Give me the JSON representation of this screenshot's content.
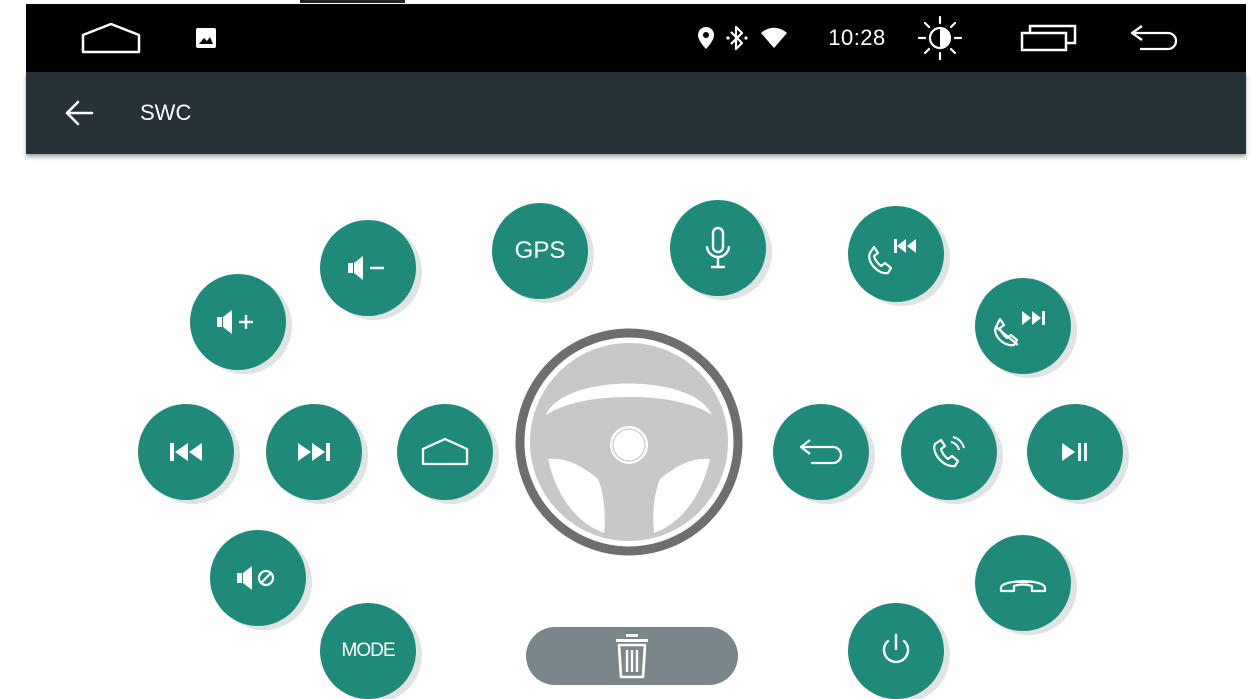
{
  "status_bar": {
    "time": "10:28",
    "icons": [
      "home-outline-icon",
      "gallery-icon",
      "location-pin-icon",
      "bluetooth-icon",
      "wifi-icon",
      "brightness-icon",
      "recent-apps-icon",
      "back-icon"
    ]
  },
  "app_bar": {
    "title": "SWC",
    "back_icon": "arrow-left-icon"
  },
  "swc_buttons": [
    {
      "name": "volume-down",
      "icon": "volume-down-icon"
    },
    {
      "name": "gps",
      "label": "GPS"
    },
    {
      "name": "voice",
      "icon": "microphone-icon"
    },
    {
      "name": "answer-previous",
      "icon": "phone-previous-icon"
    },
    {
      "name": "volume-up",
      "icon": "volume-up-icon"
    },
    {
      "name": "hangup-next",
      "icon": "hangup-next-icon"
    },
    {
      "name": "previous",
      "icon": "skip-previous-icon"
    },
    {
      "name": "next",
      "icon": "skip-next-icon"
    },
    {
      "name": "home",
      "icon": "home-icon"
    },
    {
      "name": "back",
      "icon": "back-icon"
    },
    {
      "name": "answer",
      "icon": "phone-answer-icon"
    },
    {
      "name": "play-pause",
      "icon": "play-pause-icon"
    },
    {
      "name": "mute",
      "icon": "mute-icon"
    },
    {
      "name": "hangup",
      "icon": "phone-hangup-icon"
    },
    {
      "name": "mode",
      "label": "MODE"
    },
    {
      "name": "power",
      "icon": "power-icon"
    }
  ],
  "center": {
    "icon": "steering-wheel-icon"
  },
  "delete_button": {
    "icon": "trash-icon"
  },
  "colors": {
    "accent": "#1f8a7a",
    "status_bar": "#000000",
    "app_bar": "#263238",
    "delete_pill": "#7b868b",
    "wheel_ring": "#6e6e6e",
    "wheel_body": "#c8c8c8"
  }
}
